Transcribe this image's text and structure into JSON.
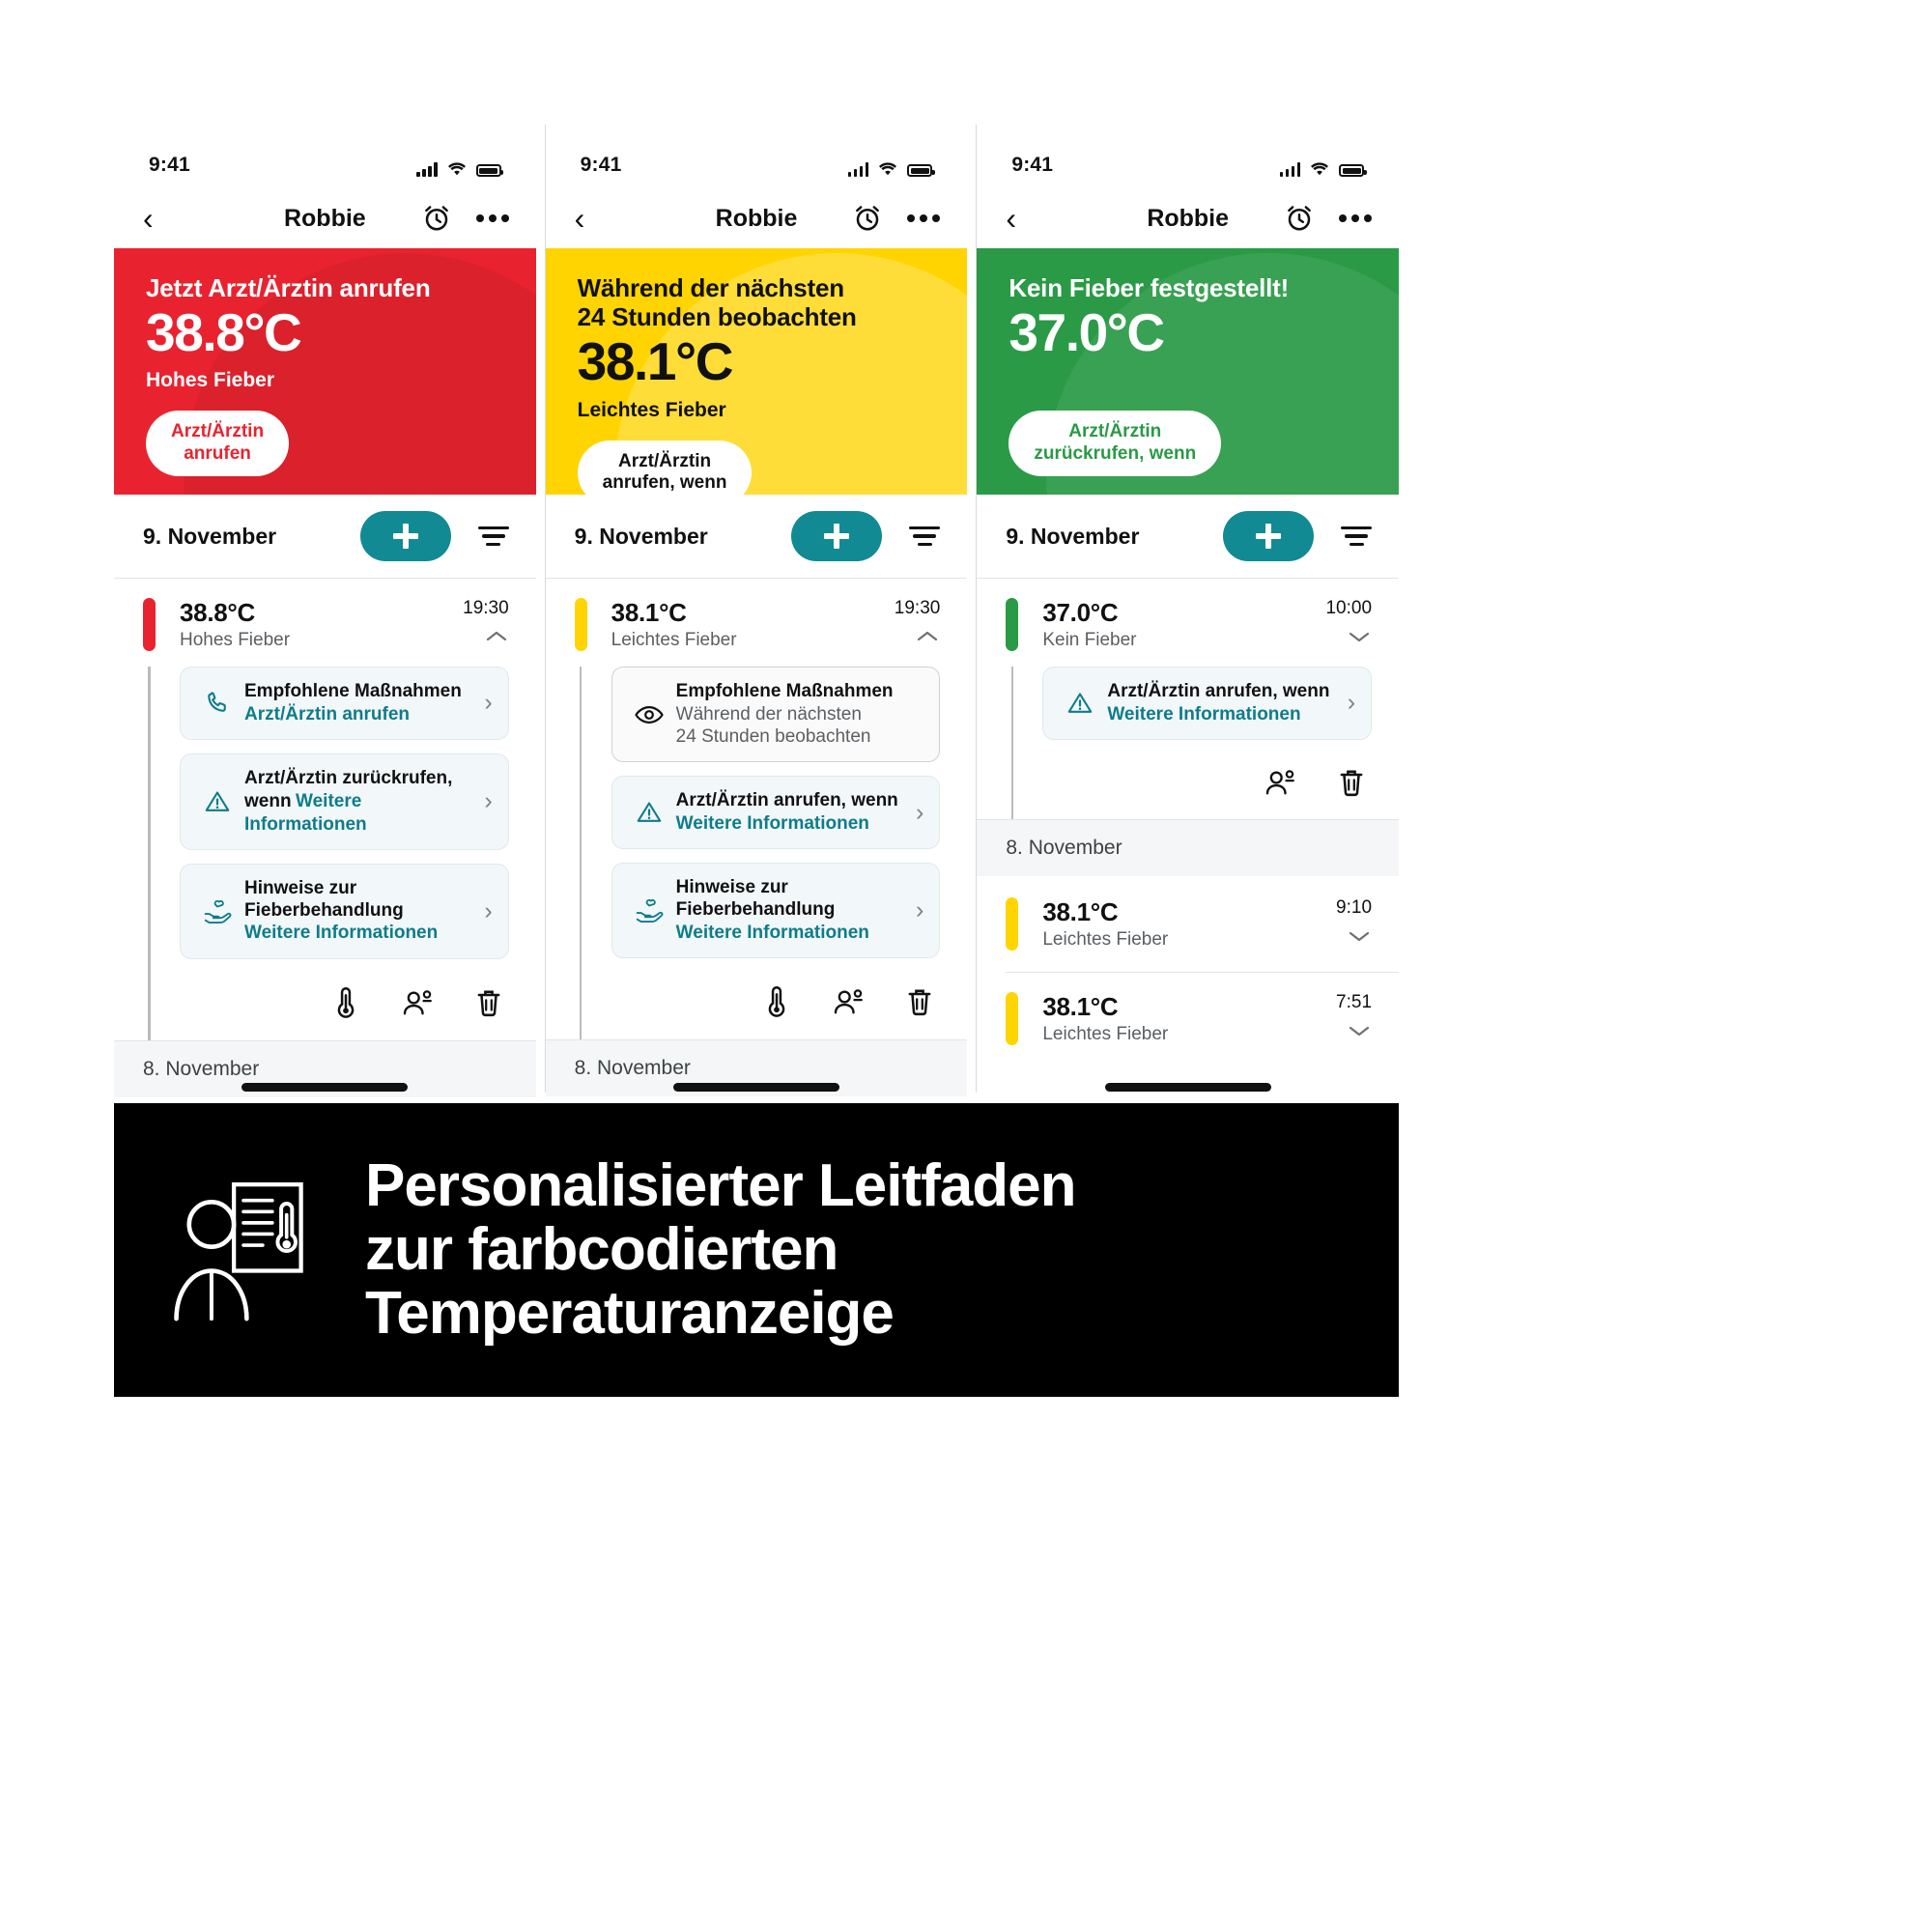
{
  "statusbar": {
    "time": "9:41"
  },
  "nav": {
    "title": "Robbie"
  },
  "common": {
    "date_today": "9. November",
    "section_prev": "8. November",
    "chevron_right": "›",
    "chevron_up": "⌃",
    "chevron_down": "⌄"
  },
  "panels": [
    {
      "id": "red",
      "accent": "#e8232f",
      "hero": {
        "headline": "Jetzt Arzt/Ärztin anrufen",
        "temperature": "38.8°C",
        "status": "Hohes Fieber",
        "button": "Arzt/Ärztin\nanrufen"
      },
      "date": "9. November",
      "measurement": {
        "temperature": "38.8°C",
        "label": "Hohes Fieber",
        "time": "19:30",
        "expanded": true
      },
      "cards": [
        {
          "icon": "phone-icon",
          "title": "Empfohlene Maßnahmen",
          "link": "Arzt/Ärztin anrufen",
          "style": "tinted",
          "arrow": true
        },
        {
          "icon": "warning-icon",
          "title": "Arzt/Ärztin zurückrufen, wenn",
          "link": "Weitere Informationen",
          "style": "tinted",
          "arrow": true
        },
        {
          "icon": "care-hand-icon",
          "title": "Hinweise zur Fieberbehandlung",
          "link": "Weitere Informationen",
          "style": "tinted",
          "arrow": true
        }
      ],
      "actions": [
        "thermometer-icon",
        "person-remove-icon",
        "trash-icon"
      ],
      "section": "8. November"
    },
    {
      "id": "yellow",
      "accent": "#ffd400",
      "hero": {
        "headline": "Während der nächsten\n24 Stunden beobachten",
        "temperature": "38.1°C",
        "status": "Leichtes Fieber",
        "button": "Arzt/Ärztin\nanrufen, wenn"
      },
      "date": "9. November",
      "measurement": {
        "temperature": "38.1°C",
        "label": "Leichtes Fieber",
        "time": "19:30",
        "expanded": true
      },
      "cards": [
        {
          "icon": "eye-icon",
          "title": "Empfohlene Maßnahmen",
          "link": "Während der nächsten\n24 Stunden beobachten",
          "style": "plain",
          "arrow": false
        },
        {
          "icon": "warning-icon",
          "title": "Arzt/Ärztin anrufen, wenn",
          "link": "Weitere Informationen",
          "style": "tinted",
          "arrow": true
        },
        {
          "icon": "care-hand-icon",
          "title": "Hinweise zur\nFieberbehandlung",
          "link": "Weitere Informationen",
          "style": "tinted",
          "arrow": true
        }
      ],
      "actions": [
        "thermometer-icon",
        "person-remove-icon",
        "trash-icon"
      ],
      "section": "8. November"
    },
    {
      "id": "green",
      "accent": "#2a9a46",
      "hero": {
        "headline": "Kein Fieber festgestellt!",
        "temperature": "37.0°C",
        "status": "",
        "button": "Arzt/Ärztin\nzurückrufen, wenn"
      },
      "date": "9. November",
      "measurement": {
        "temperature": "37.0°C",
        "label": "Kein Fieber",
        "time": "10:00",
        "expanded": true
      },
      "cards": [
        {
          "icon": "warning-icon",
          "title": "Arzt/Ärztin anrufen, wenn",
          "link": "Weitere Informationen",
          "style": "tinted",
          "arrow": true
        }
      ],
      "actions": [
        "person-remove-icon",
        "trash-icon"
      ],
      "section": "8. November",
      "history": [
        {
          "temperature": "38.1°C",
          "label": "Leichtes Fieber",
          "time": "9:10",
          "pill": "yellow"
        },
        {
          "temperature": "38.1°C",
          "label": "Leichtes Fieber",
          "time": "7:51",
          "pill": "yellow"
        }
      ]
    }
  ],
  "banner": {
    "icon": "person-with-chart-icon",
    "caption": "Personalisierter Leitfaden\nzur farbcodierten\nTemperaturanzeige"
  }
}
